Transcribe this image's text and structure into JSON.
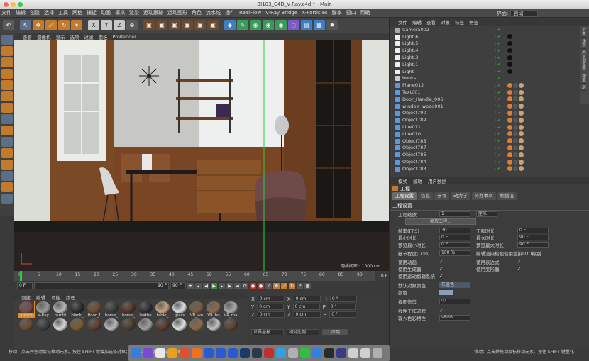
{
  "window": {
    "title": "BI103_C4D_V-Ray.c4d * - Main"
  },
  "menu": {
    "items": [
      "文件",
      "编辑",
      "创建",
      "选择",
      "工具",
      "网格",
      "捕捉",
      "动画",
      "模拟",
      "渲染",
      "运动跟踪",
      "运动图形",
      "角色",
      "流水线",
      "插件",
      "RealFlow",
      "V-Ray Bridge",
      "X-Particles",
      "脚本",
      "窗口",
      "帮助"
    ],
    "layout_label": "界面:",
    "layout_value": "启动"
  },
  "toolbar": {
    "xyz": [
      "X",
      "Y",
      "Z"
    ]
  },
  "viewport": {
    "menu": [
      "查看",
      "摄像机",
      "显示",
      "选项",
      "过滤",
      "面板",
      "ProRender"
    ],
    "grid_label": "网格间距 : 1000 cm"
  },
  "timeline": {
    "ticks": [
      "0",
      "5",
      "10",
      "15",
      "20",
      "25",
      "30",
      "35",
      "40",
      "45",
      "50",
      "55",
      "60",
      "65",
      "70",
      "75",
      "80",
      "85",
      "90"
    ],
    "end_frame": "0 F"
  },
  "transport": {
    "start": "0 F",
    "end": "90 F",
    "max": "90 F"
  },
  "materials": {
    "tabs": [
      "创建",
      "编辑",
      "功能",
      "纹理"
    ],
    "items": [
      {
        "label": "armch",
        "color": "#7a4a46"
      },
      {
        "label": "V-Ray",
        "color": "#9a9a9a"
      },
      {
        "label": "tumbl",
        "color": "#b8b8b8"
      },
      {
        "label": "black_",
        "color": "#2a2a2a"
      },
      {
        "label": "floor_1",
        "color": "#6b4a2a"
      },
      {
        "label": "horse_",
        "color": "#3a3a3a"
      },
      {
        "label": "horse_",
        "color": "#553322"
      },
      {
        "label": "leathe",
        "color": "#2e2e2e"
      },
      {
        "label": "table_",
        "color": "#c9a27a"
      },
      {
        "label": "glass",
        "color": "#dddddd"
      },
      {
        "label": "VR_wo",
        "color": "#7a5a3a"
      },
      {
        "label": "VR_bo",
        "color": "#8a6a4a"
      },
      {
        "label": "VR_ma",
        "color": "#aaaaaa"
      },
      {
        "label": "",
        "color": "#6a4a2a"
      },
      {
        "label": "",
        "color": "#3a3a3a"
      },
      {
        "label": "",
        "color": "#d8d8d8"
      },
      {
        "label": "",
        "color": "#7a5a2a"
      },
      {
        "label": "",
        "color": "#5a3a2a"
      },
      {
        "label": "",
        "color": "#bbbbbb"
      },
      {
        "label": "",
        "color": "#4a3a2a"
      },
      {
        "label": "",
        "color": "#a0a0a0"
      },
      {
        "label": "",
        "color": "#553a2a"
      },
      {
        "label": "",
        "color": "#e0e0e0"
      },
      {
        "label": "",
        "color": "#8a6a40"
      },
      {
        "label": "",
        "color": "#c0c0c0"
      },
      {
        "label": "",
        "color": "#5a4030"
      }
    ]
  },
  "coords": {
    "rows": [
      {
        "a": "X",
        "av": "0 cm",
        "b": "X",
        "bv": "0 cm",
        "c": "H",
        "cv": "0 °"
      },
      {
        "a": "Y",
        "av": "0 cm",
        "b": "Y",
        "bv": "0 cm",
        "c": "P",
        "cv": "0 °"
      },
      {
        "a": "Z",
        "av": "0 cm",
        "b": "Z",
        "bv": "0 cm",
        "c": "B",
        "cv": "0 °"
      }
    ],
    "mode": "世界坐标",
    "scale": "相对比例",
    "apply": "应用"
  },
  "objects": {
    "menu": [
      "文件",
      "编辑",
      "查看",
      "对象",
      "标签",
      "书签"
    ],
    "list": [
      {
        "name": "Camera002",
        "type": "cam"
      },
      {
        "name": "Light.6",
        "type": "light"
      },
      {
        "name": "Light.5",
        "type": "light"
      },
      {
        "name": "Light.4",
        "type": "light"
      },
      {
        "name": "Light.3",
        "type": "light"
      },
      {
        "name": "Light.1",
        "type": "light"
      },
      {
        "name": "Light",
        "type": "light"
      },
      {
        "name": "books",
        "type": "null"
      },
      {
        "name": "Plane012",
        "type": "obj"
      },
      {
        "name": "Text001",
        "type": "obj"
      },
      {
        "name": "Door_Handle_006",
        "type": "obj"
      },
      {
        "name": "window_wood001",
        "type": "obj"
      },
      {
        "name": "Object790",
        "type": "obj"
      },
      {
        "name": "Object789",
        "type": "obj"
      },
      {
        "name": "Line011",
        "type": "obj"
      },
      {
        "name": "Line010",
        "type": "obj"
      },
      {
        "name": "Object788",
        "type": "obj"
      },
      {
        "name": "Object787",
        "type": "obj"
      },
      {
        "name": "Object786",
        "type": "obj"
      },
      {
        "name": "Object784",
        "type": "obj"
      },
      {
        "name": "Object783",
        "type": "obj"
      }
    ]
  },
  "sidetabs": [
    "对象",
    "场次",
    "内容浏览器",
    "构造",
    "层"
  ],
  "attributes": {
    "menu": [
      "模式",
      "编辑",
      "用户数据"
    ],
    "title": "工程",
    "tabs": [
      "工程设置",
      "信息",
      "参考",
      "动力学",
      "待办事项",
      "帧插值"
    ],
    "section": "工程设置",
    "scale_label": "工程缩放",
    "scale_value": "1",
    "scale_unit": "厘米",
    "scale_button": "缩放工程...",
    "rows": [
      {
        "l": "帧率(FPS)",
        "v": "30",
        "l2": "工程时长",
        "v2": "0 F"
      },
      {
        "l": "最小时长",
        "v": "0 F",
        "l2": "最大时长",
        "v2": "90 F"
      },
      {
        "l": "预览最小时长",
        "v": "0 F",
        "l2": "预览最大时长",
        "v2": "90 F"
      }
    ],
    "lod_label": "细节程度(LOD)",
    "lod_value": "100 %",
    "lod_check": "编辑渲染检视使用渲染LOD级别",
    "checks": [
      {
        "l": "使用动画",
        "l2": "使用表达式"
      },
      {
        "l": "使用生成器",
        "l2": "使用变形器"
      },
      {
        "l": "使用运动剪辑系统",
        "l2": ""
      }
    ],
    "default_color_label": "默认对象颜色",
    "default_color_value": "灰蓝色",
    "color_label": "颜色",
    "view_label": "视图修剪",
    "view_value": "中",
    "linear_label": "线性工作流程",
    "input_label": "输入色彩特性",
    "input_value": "sRGB"
  },
  "status": {
    "left": "移动：点击并拖动鼠标移动元素。按住 SHIFT 键增加选择对象；按住 CTRL 键减少选择对象。",
    "right": "移动：点击并拖动鼠标移动元素。按住 SHIFT 键量化"
  }
}
